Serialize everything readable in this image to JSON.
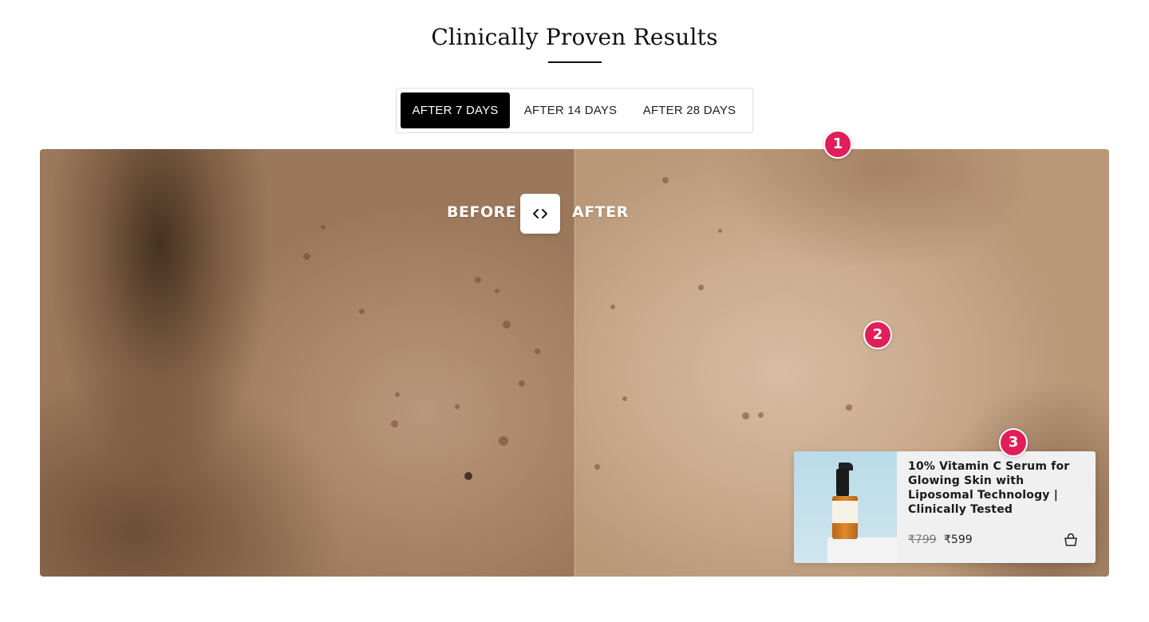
{
  "section": {
    "title": "Clinically Proven Results"
  },
  "tabs": [
    {
      "label": "AFTER 7 DAYS",
      "active": true
    },
    {
      "label": "AFTER 14 DAYS",
      "active": false
    },
    {
      "label": "AFTER 28 DAYS",
      "active": false
    }
  ],
  "comparison": {
    "before_label": "BEFORE",
    "after_label": "AFTER",
    "handle_icon": "code-arrows-icon"
  },
  "hotspots": [
    {
      "number": "1"
    },
    {
      "number": "2"
    },
    {
      "number": "3"
    }
  ],
  "product_card": {
    "title": "10% Vitamin C Serum for Glowing Skin with Liposomal Technology | Clinically Tested",
    "price_original": "₹799",
    "price_current": "₹599",
    "cart_icon": "shopping-basket-icon"
  },
  "colors": {
    "accent": "#e01f5a",
    "tab_active_bg": "#000000",
    "tab_active_text": "#ffffff"
  }
}
